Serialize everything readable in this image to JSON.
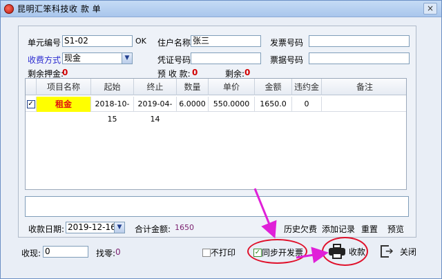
{
  "window": {
    "title": "昆明汇笨科技收 款 单",
    "close_glyph": "×"
  },
  "form": {
    "unit_no_label": "单元编号",
    "unit_no_value": "S1-02",
    "ok_label": "OK",
    "resident_label": "住户名称",
    "resident_value": "张三",
    "invoice_no_label": "发票号码",
    "invoice_no_value": "",
    "pay_method_label": "收费方式",
    "pay_method_value": "现金",
    "voucher_label": "凭证号码",
    "voucher_value": "",
    "receipt_no_label": "票据号码",
    "receipt_no_value": "",
    "deposit_label": "剩余押金:",
    "deposit_value": "0",
    "prepaid_label": "预 收 款:",
    "prepaid_value": "0",
    "remain_label": "剩余:",
    "remain_value": "0"
  },
  "table": {
    "headers": [
      "",
      "项目名称",
      "起始",
      "终止",
      "数量",
      "单价",
      "金额",
      "违约金",
      "备注"
    ],
    "rows": [
      {
        "checked": "✓",
        "name": "租金",
        "start": "2018-10-15",
        "end": "2019-04-14",
        "qty": "6.0000",
        "price": "550.0000",
        "amount": "1650.0",
        "penalty": "0",
        "note": ""
      }
    ]
  },
  "footer": {
    "date_label": "收款日期:",
    "date_value": "2019-12-16",
    "total_label": "合计金额:",
    "total_value": "1650",
    "history_label": "历史欠费",
    "add_label": "添加记录",
    "reset_label": "重置",
    "preview_label": "预览",
    "cash_label": "收现:",
    "cash_value": "0",
    "change_label": "找零:",
    "change_value": "0",
    "no_print_label": "不打印",
    "sync_invoice_label": "同步开发票",
    "sync_invoice_check": "✓",
    "collect_label": "收款",
    "close_label": "关闭"
  },
  "colors": {
    "highlight_red": "#e0102a",
    "arrow_magenta": "#e020d8",
    "item_yellow": "#ffff00"
  }
}
